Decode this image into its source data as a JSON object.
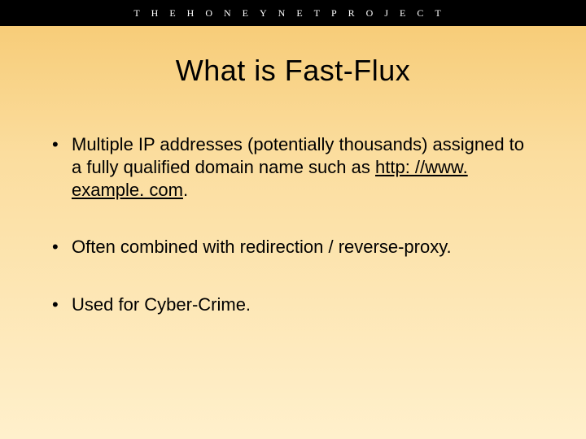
{
  "header": {
    "segments": [
      "THE",
      "HONEYNET",
      "PROJECT"
    ]
  },
  "title": "What is Fast-Flux",
  "bullets": [
    {
      "pre": "Multiple IP addresses (potentially thousands) assigned to a fully qualified domain name such as ",
      "link": "http: //www. example. com",
      "post": "."
    },
    {
      "pre": "Often combined with redirection / reverse-proxy.",
      "link": "",
      "post": ""
    },
    {
      "pre": "Used for Cyber-Crime.",
      "link": "",
      "post": ""
    }
  ]
}
